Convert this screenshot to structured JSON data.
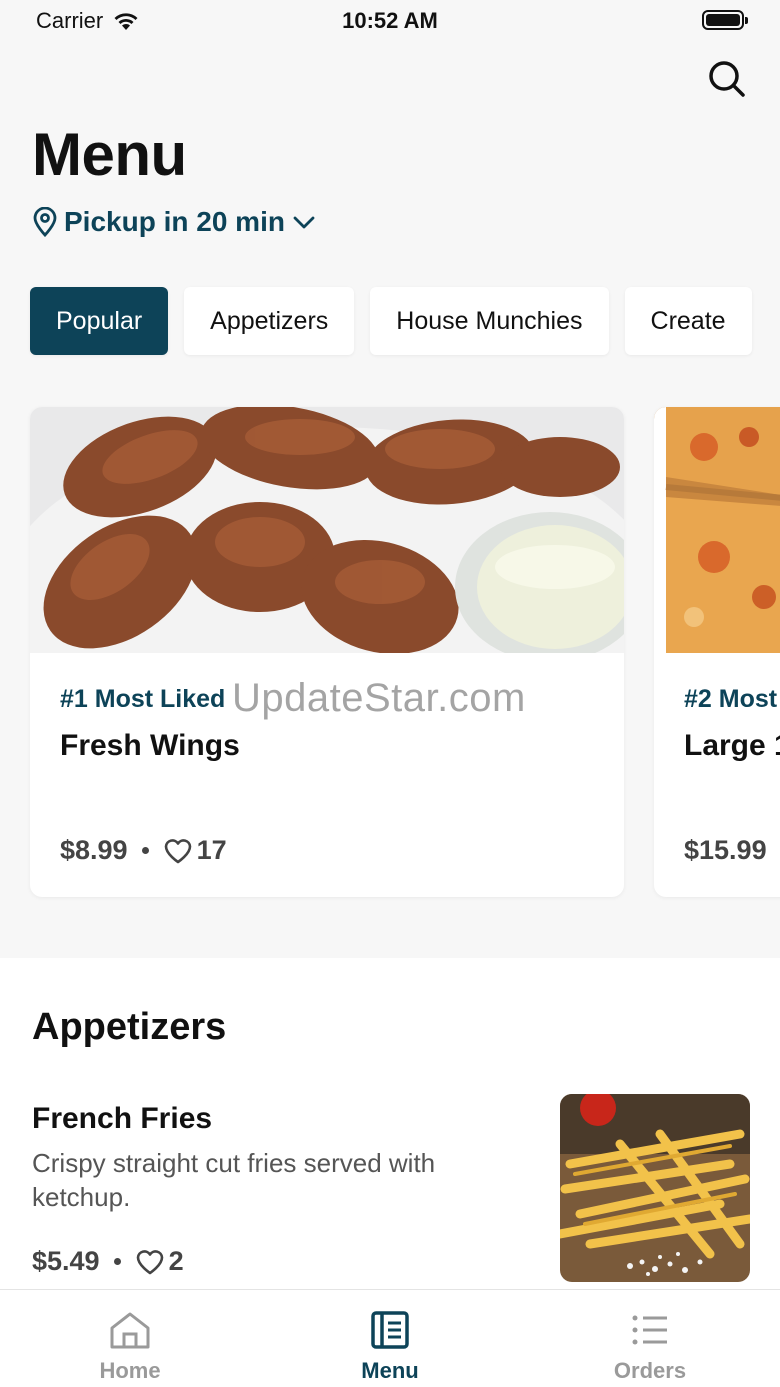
{
  "status_bar": {
    "carrier": "Carrier",
    "time": "10:52 AM"
  },
  "header": {
    "title": "Menu",
    "pickup_label": "Pickup in 20 min"
  },
  "tabs": [
    {
      "label": "Popular",
      "active": true
    },
    {
      "label": "Appetizers",
      "active": false
    },
    {
      "label": "House Munchies",
      "active": false
    },
    {
      "label": "Create",
      "active": false
    }
  ],
  "featured": [
    {
      "rank": "#1 Most Liked",
      "name": "Fresh Wings",
      "price": "$8.99",
      "likes": "17",
      "image": "wings-photo"
    },
    {
      "rank": "#2 Most",
      "name": "Large 1",
      "price": "$15.99",
      "likes": "",
      "image": "pizza-photo"
    }
  ],
  "watermark": "UpdateStar.com",
  "appetizers": {
    "title": "Appetizers",
    "items": [
      {
        "name": "French Fries",
        "description": "Crispy straight cut fries served with ketchup.",
        "price": "$5.49",
        "likes": "2",
        "image": "fries-photo"
      }
    ]
  },
  "bottom_nav": [
    {
      "label": "Home",
      "icon": "home-icon",
      "active": false
    },
    {
      "label": "Menu",
      "icon": "menu-book-icon",
      "active": true
    },
    {
      "label": "Orders",
      "icon": "list-icon",
      "active": false
    }
  ],
  "colors": {
    "accent": "#0d4358",
    "background": "#f7f7f7",
    "inactive": "#9a9a9a"
  }
}
